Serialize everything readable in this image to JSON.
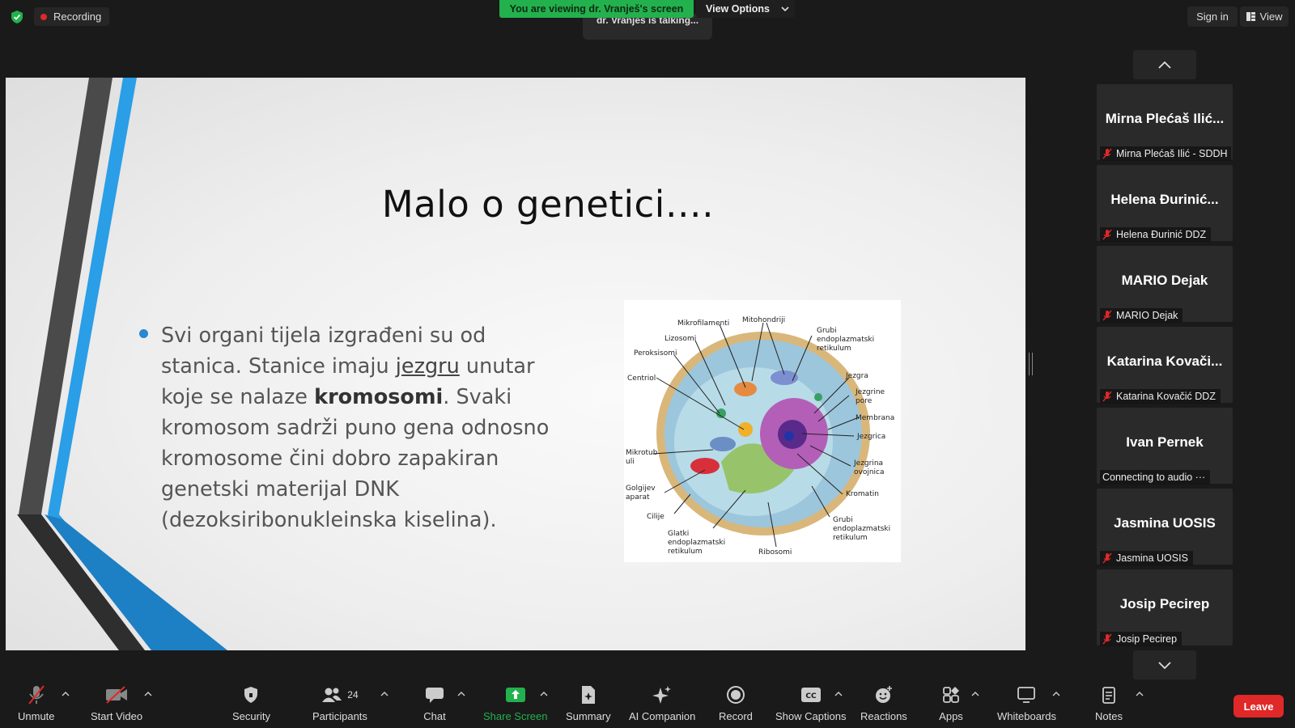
{
  "topbar": {
    "recording_label": "Recording",
    "viewing_banner": "You are viewing dr. Vranješ's screen",
    "view_options_label": "View Options",
    "talking_indicator": "dr. Vranješ is talking...",
    "sign_in_label": "Sign in",
    "view_label": "View"
  },
  "slide": {
    "title": "Malo o genetici….",
    "text_1": "Svi organi  tijela izgrađeni su od stanica. Stanice imaju ",
    "text_underlined": "jezgru",
    "text_2": " unutar koje se nalaze ",
    "text_bold": "kromosomi",
    "text_3": ". Svaki kromosom sadrži puno gena odnosno kromosome čini dobro zapakiran genetski materijal DNK (dezoksiribonukleinska kiselina).",
    "cell_labels": [
      "Mikrofilamenti",
      "Mitohondriji",
      "Grubi",
      "endoplazmatski",
      "retikulum",
      "Lizosomi",
      "Peroksisomi",
      "Centriol",
      "Jezgra",
      "Jezgrine",
      "pore",
      "Membrana",
      "Jezgrica",
      "Mikrotub",
      "uli",
      "Jezgrina",
      "ovojnica",
      "Golgijev",
      "aparat",
      "Kromatin",
      "Cilije",
      "Grubi",
      "endoplazmatski",
      "retikulum",
      "Glatki",
      "endoplazmatski",
      "retikulum",
      "Ribosomi"
    ]
  },
  "participants": [
    {
      "name": "Mirna Plećaš Ilić...",
      "label": "Mirna Plećaš Ilić - SDDH",
      "muted": true
    },
    {
      "name": "Helena Đurinić...",
      "label": "Helena Đurinić DDZ",
      "muted": true
    },
    {
      "name": "MARIO Dejak",
      "label": "MARIO Dejak",
      "muted": true
    },
    {
      "name": "Katarina Kovači...",
      "label": "Katarina Kovačić DDZ",
      "muted": true
    },
    {
      "name": "Ivan Pernek",
      "label": "Connecting to audio ···",
      "muted": false
    },
    {
      "name": "Jasmina UOSIS",
      "label": "Jasmina UOSIS",
      "muted": true
    },
    {
      "name": "Josip Pecirep",
      "label": "Josip Pecirep",
      "muted": true
    }
  ],
  "toolbar": {
    "unmute": "Unmute",
    "start_video": "Start Video",
    "security": "Security",
    "participants": "Participants",
    "participant_count": "24",
    "chat": "Chat",
    "share_screen": "Share Screen",
    "summary": "Summary",
    "ai_companion": "AI Companion",
    "record": "Record",
    "show_captions": "Show Captions",
    "reactions": "Reactions",
    "apps": "Apps",
    "whiteboards": "Whiteboards",
    "notes": "Notes",
    "leave": "Leave"
  },
  "colors": {
    "share_green": "#23b14d",
    "leave_red": "#e02828",
    "slide_blue": "#2a9ee6"
  }
}
